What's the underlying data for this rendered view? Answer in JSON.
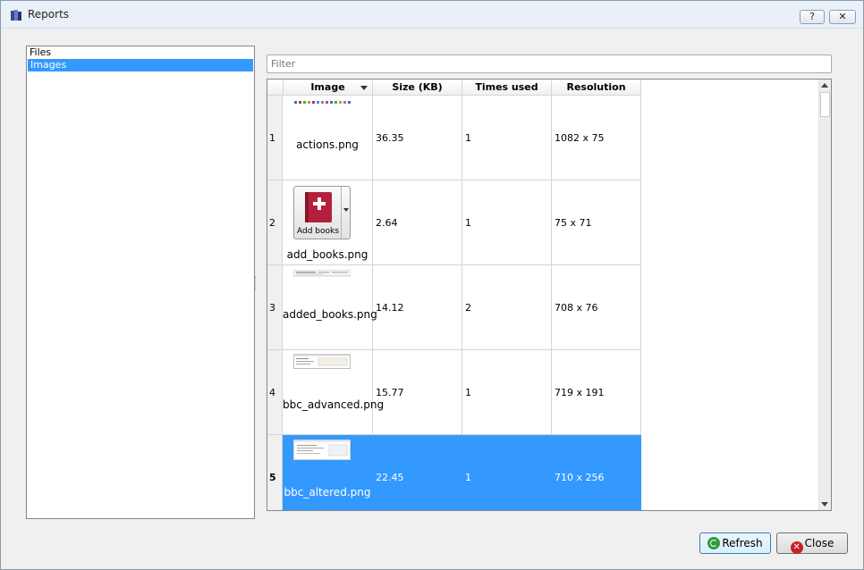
{
  "window": {
    "title": "Reports",
    "help_label": "?",
    "close_label": "✕"
  },
  "sidebar": {
    "items": [
      {
        "label": "Files",
        "selected": false
      },
      {
        "label": "Images",
        "selected": true
      }
    ]
  },
  "filter": {
    "placeholder": "Filter",
    "value": ""
  },
  "table": {
    "columns": [
      "Image",
      "Size (KB)",
      "Times used",
      "Resolution"
    ],
    "sort_column": "Image",
    "rows": [
      {
        "num": "1",
        "name": "actions.png",
        "size": "36.35",
        "used": "1",
        "resolution": "1082 x 75"
      },
      {
        "num": "2",
        "name": "add_books.png",
        "size": "2.64",
        "used": "1",
        "resolution": "75 x 71",
        "thumb_label": "Add books"
      },
      {
        "num": "3",
        "name": "added_books.png",
        "size": "14.12",
        "used": "2",
        "resolution": "708 x 76"
      },
      {
        "num": "4",
        "name": "bbc_advanced.png",
        "size": "15.77",
        "used": "1",
        "resolution": "719 x 191"
      },
      {
        "num": "5",
        "name": "bbc_altered.png",
        "size": "22.45",
        "used": "1",
        "resolution": "710 x 256",
        "selected": true
      }
    ]
  },
  "buttons": {
    "refresh": "Refresh",
    "close": "Close"
  },
  "colors": {
    "selection": "#3399ff",
    "book_red": "#b3203c"
  }
}
